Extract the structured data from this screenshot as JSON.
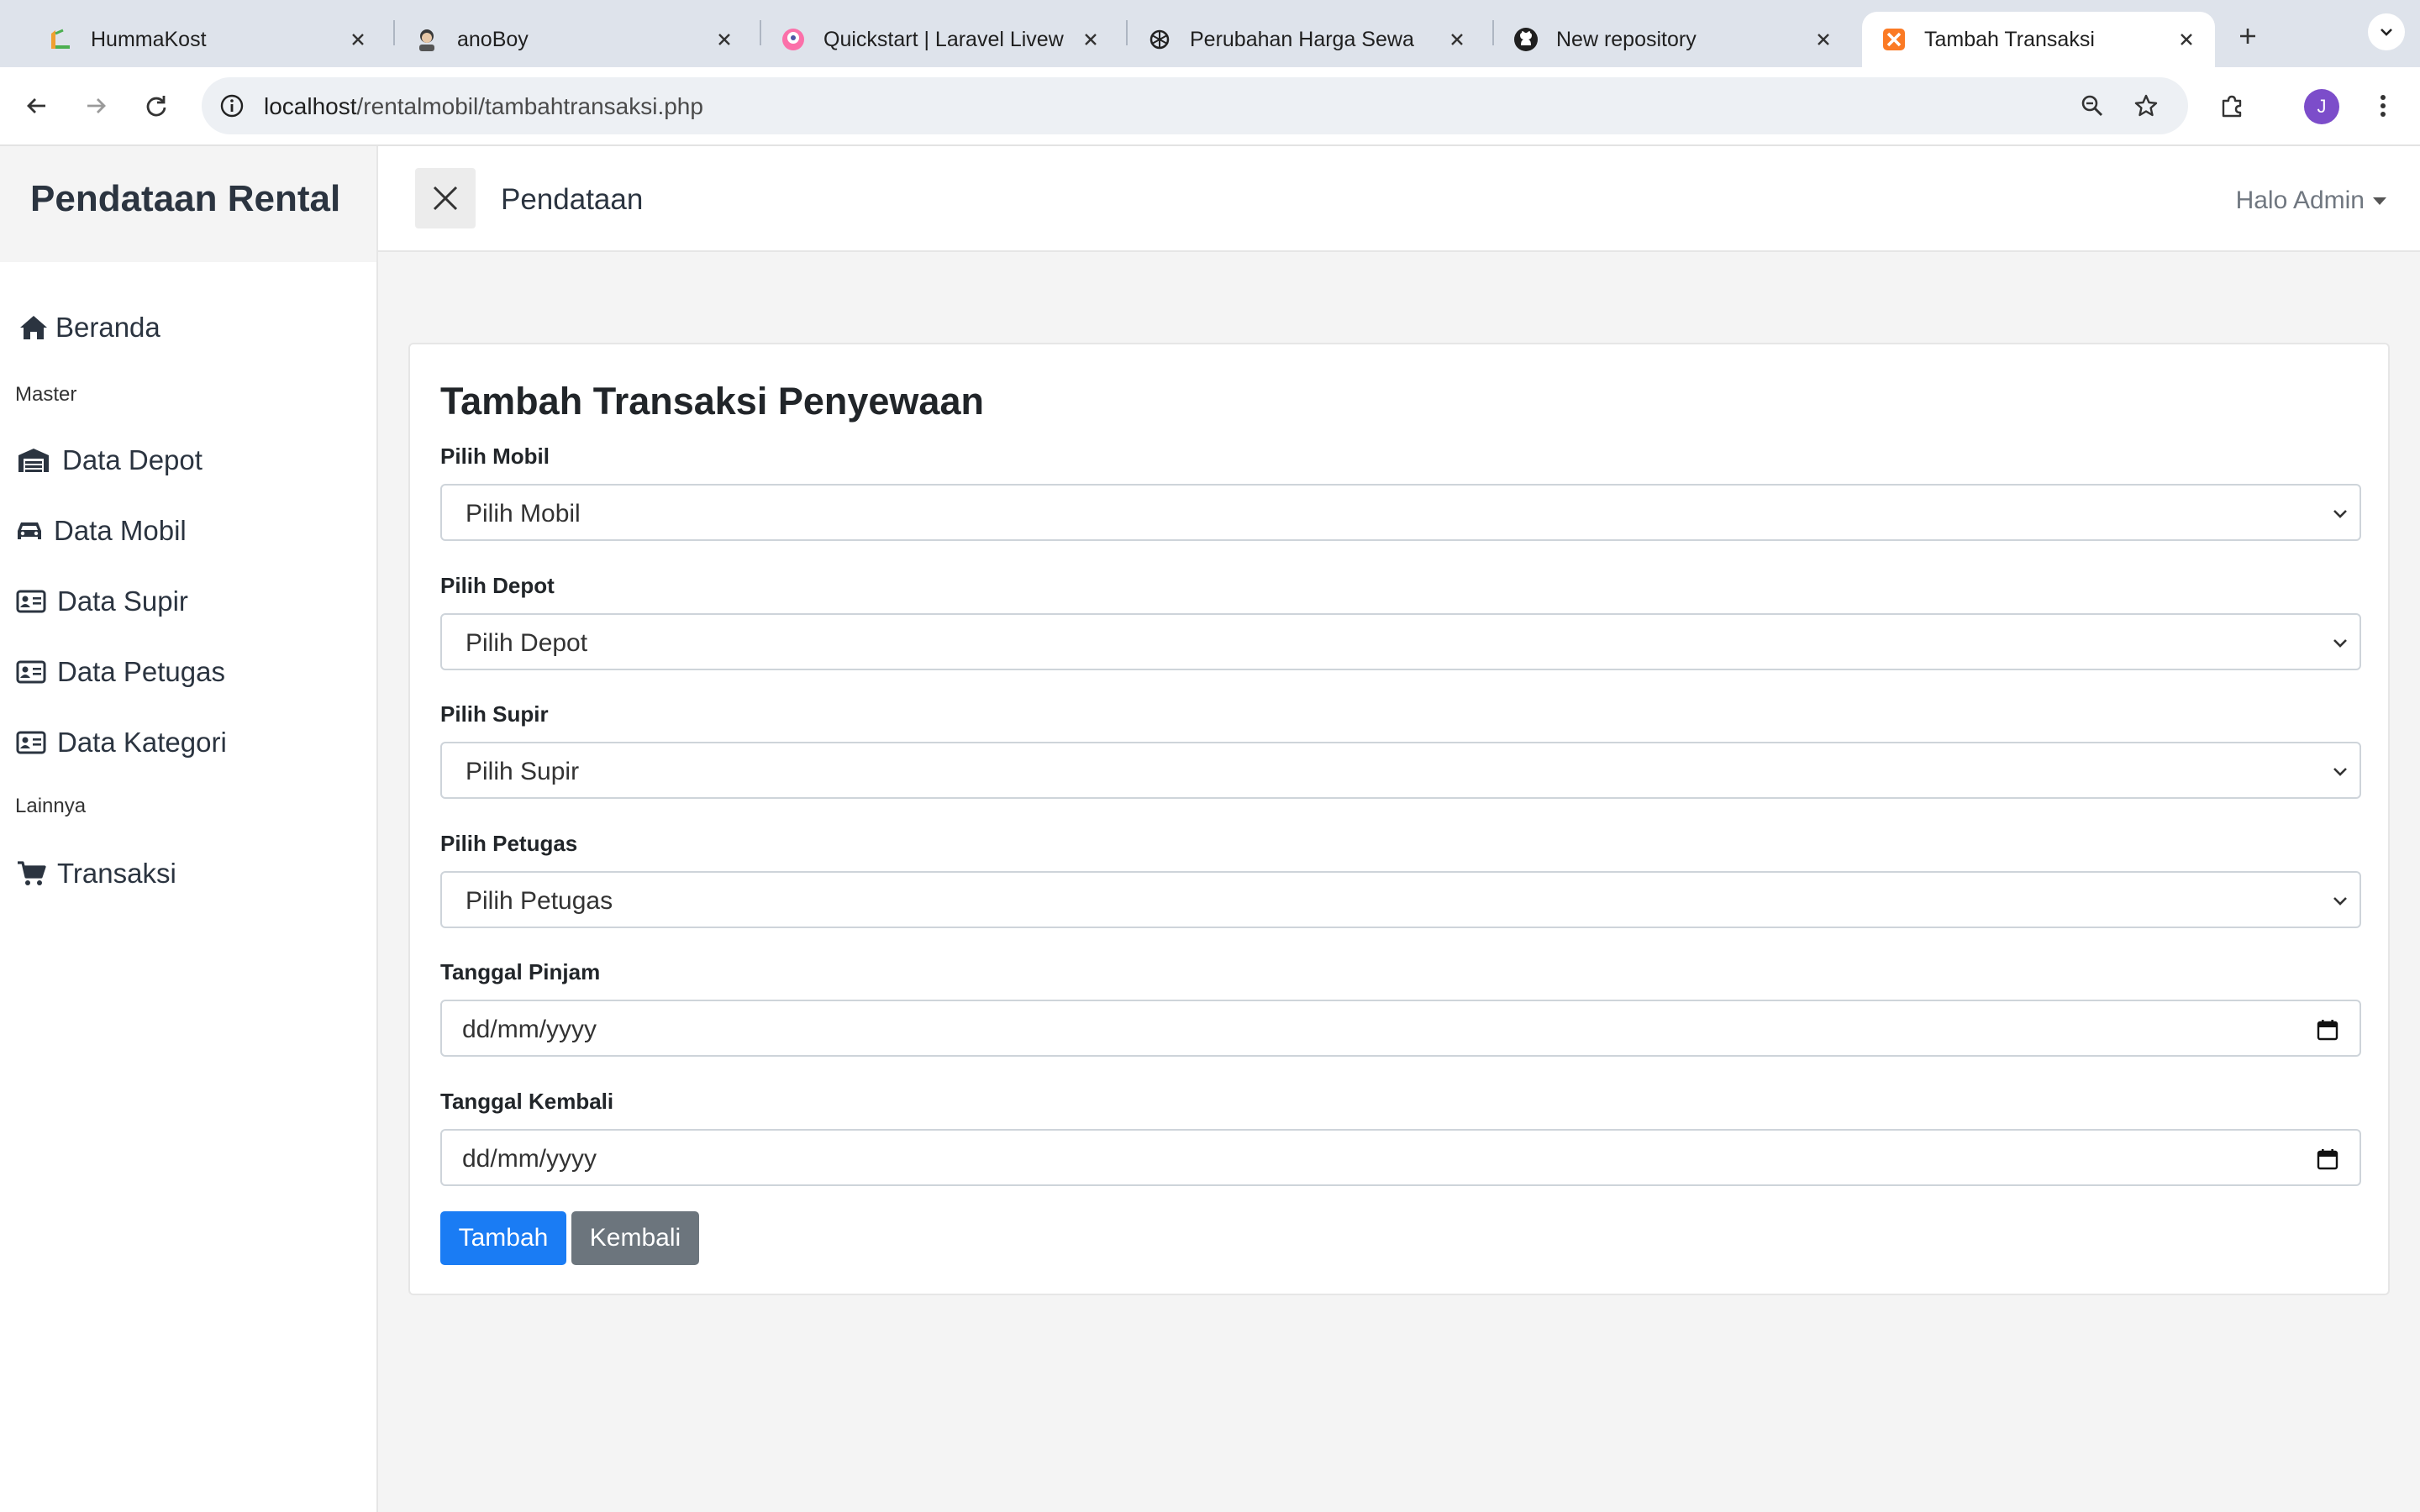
{
  "browser": {
    "tabs": [
      {
        "title": "HummaKost",
        "favicon": "hummakost-logo-icon",
        "active": false
      },
      {
        "title": "anoBoy",
        "favicon": "anoboy-avatar-icon",
        "active": false
      },
      {
        "title": "Quickstart | Laravel Livew",
        "favicon": "livewire-logo-icon",
        "active": false
      },
      {
        "title": "Perubahan Harga Sewa",
        "favicon": "openai-logo-icon",
        "active": false
      },
      {
        "title": "New repository",
        "favicon": "github-logo-icon",
        "active": false
      },
      {
        "title": "Tambah Transaksi",
        "favicon": "xampp-logo-icon",
        "active": true
      }
    ],
    "url_host": "localhost",
    "url_path": "/rentalmobil/tambahtransaksi.php",
    "profile_initial": "J",
    "profile_color": "#7c4dca"
  },
  "sidebar": {
    "brand": "Pendataan Rental",
    "items": [
      {
        "label": "Beranda",
        "icon": "home-icon"
      },
      {
        "heading": "Master"
      },
      {
        "label": "Data Depot",
        "icon": "warehouse-icon"
      },
      {
        "label": "Data Mobil",
        "icon": "car-icon"
      },
      {
        "label": "Data Supir",
        "icon": "id-card-icon"
      },
      {
        "label": "Data Petugas",
        "icon": "id-card-icon"
      },
      {
        "label": "Data Kategori",
        "icon": "id-card-icon"
      },
      {
        "heading": "Lainnya"
      },
      {
        "label": "Transaksi",
        "icon": "shopping-cart-icon"
      }
    ]
  },
  "topnav": {
    "title": "Pendataan",
    "user_menu": "Halo Admin"
  },
  "form": {
    "title": "Tambah Transaksi Penyewaan",
    "fields": [
      {
        "label": "Pilih Mobil",
        "type": "select",
        "value": "Pilih Mobil"
      },
      {
        "label": "Pilih Depot",
        "type": "select",
        "value": "Pilih Depot"
      },
      {
        "label": "Pilih Supir",
        "type": "select",
        "value": "Pilih Supir"
      },
      {
        "label": "Pilih Petugas",
        "type": "select",
        "value": "Pilih Petugas"
      },
      {
        "label": "Tanggal Pinjam",
        "type": "date",
        "placeholder": "dd/mm/yyyy"
      },
      {
        "label": "Tanggal Kembali",
        "type": "date",
        "placeholder": "dd/mm/yyyy"
      }
    ],
    "submit_label": "Tambah",
    "back_label": "Kembali"
  },
  "colors": {
    "primary": "#1a7cf4",
    "secondary": "#6c757d",
    "tabbar": "#dee3eb",
    "page_bg": "#f4f4f4"
  }
}
